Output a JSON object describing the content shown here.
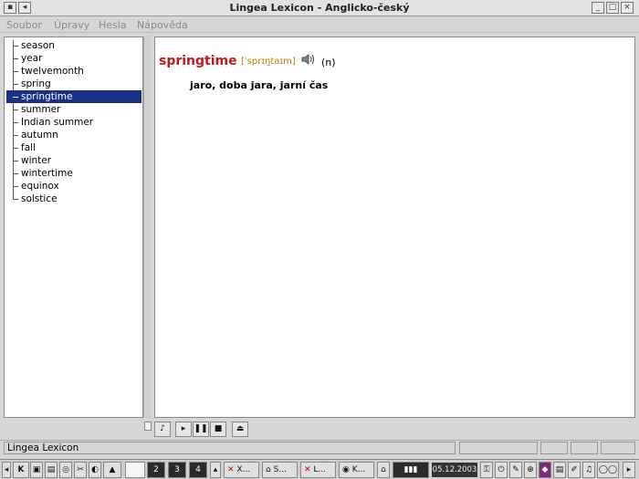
{
  "window": {
    "title": "Lingea Lexicon - Anglicko-český"
  },
  "menu": {
    "items": [
      "Soubor",
      "Úpravy",
      "Hesla",
      "Nápověda"
    ]
  },
  "tree": {
    "items": [
      "season",
      "year",
      "twelvemonth",
      "spring",
      "springtime",
      "summer",
      "Indian summer",
      "autumn",
      "fall",
      "winter",
      "wintertime",
      "equinox",
      "solstice"
    ],
    "selected_index": 4
  },
  "entry": {
    "headword": "springtime",
    "pronunciation": "[ˈsprɪŋtaɪm]",
    "part_of_speech": "(n)",
    "translation": "jaro, doba jara, jarní čas"
  },
  "status": {
    "text": "Lingea Lexicon"
  },
  "taskbar": {
    "desktops": [
      "2",
      "3",
      "4"
    ],
    "tasks": [
      "X...",
      "S...",
      "L...",
      "K..."
    ],
    "clock": "05.12.2003"
  },
  "colors": {
    "selection": "#1a2f87",
    "headword": "#c21a1a",
    "pronunciation": "#c27a00"
  }
}
